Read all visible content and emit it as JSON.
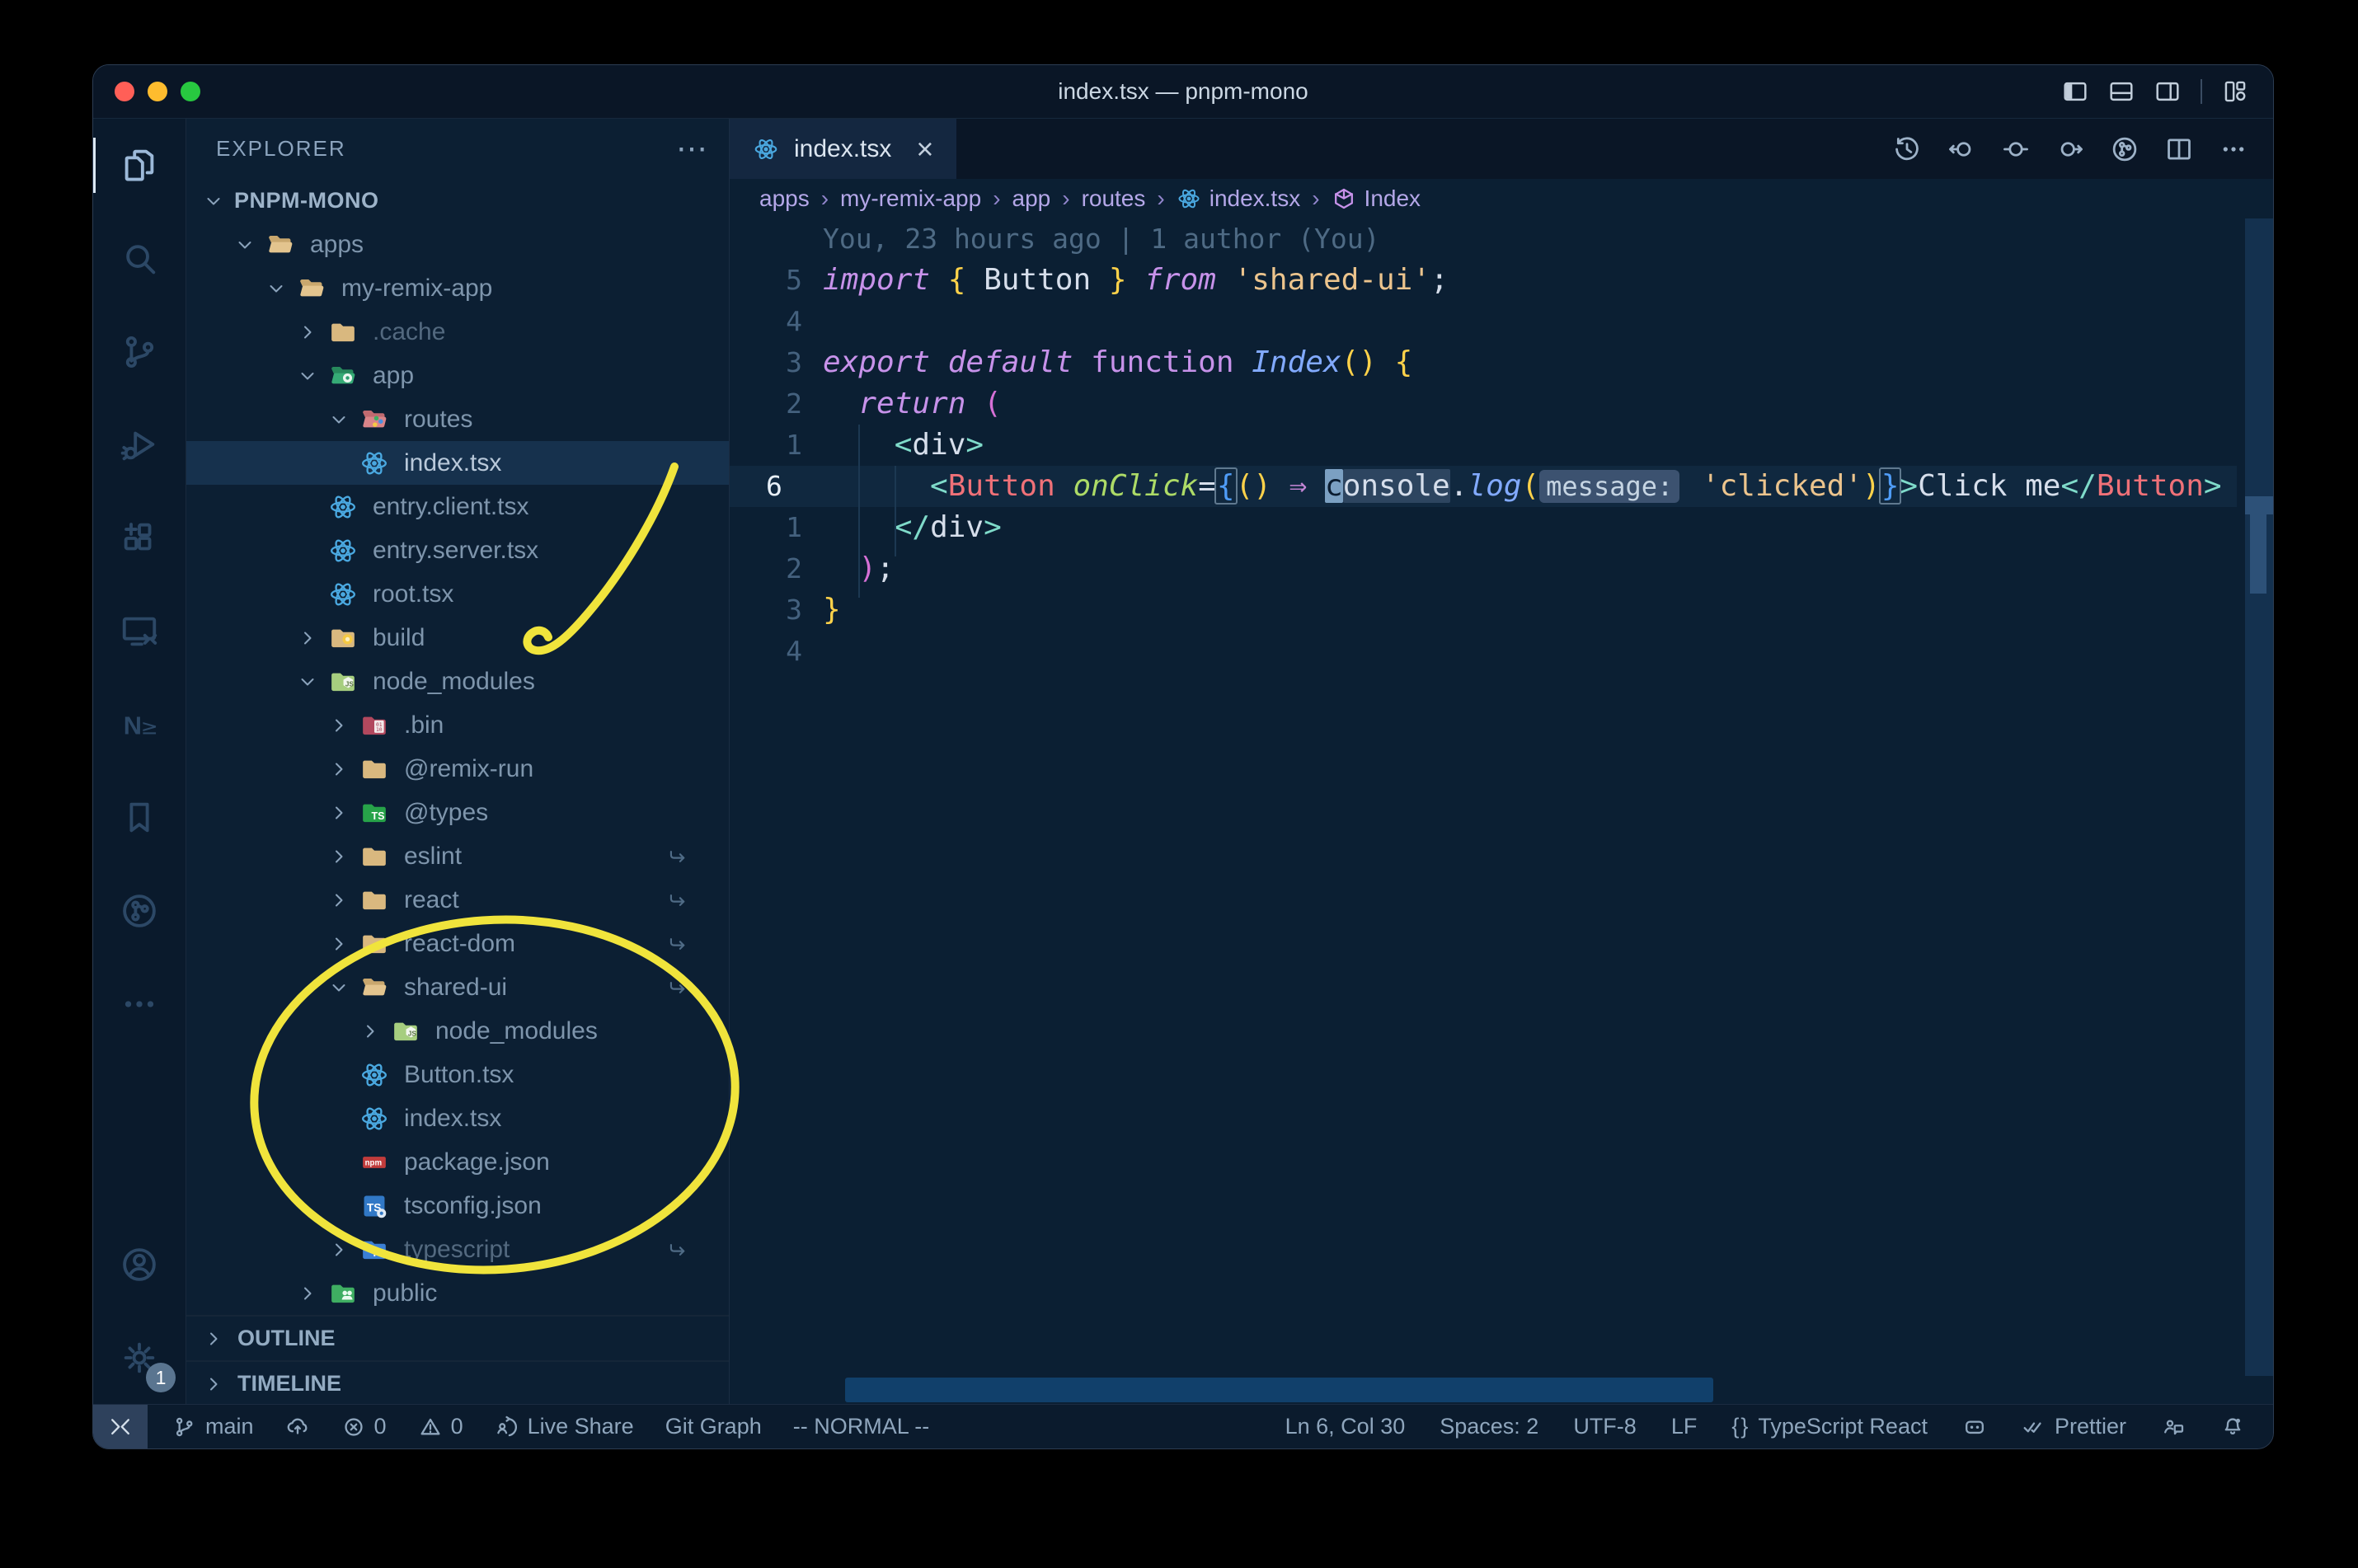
{
  "titlebar": {
    "title": "index.tsx — pnpm-mono",
    "traffic_lights": [
      "close",
      "minimize",
      "zoom"
    ],
    "layout_icons": [
      "panel-left",
      "panel-bottom",
      "panel-right",
      "layout-customize"
    ]
  },
  "colors": {
    "traffic_close": "#ff5f57",
    "traffic_min": "#febc2e",
    "traffic_zoom": "#28c840",
    "annotation_yellow": "#f0e43c",
    "editor_bg": "#0b1f33",
    "sidebar_bg": "#0c1f33",
    "statusbar_bg": "#0b1b2d",
    "keyword": "#c792ea",
    "string": "#ecc48d",
    "function": "#82aaff",
    "tag": "#f07178",
    "attribute": "#addb67",
    "punct_teal": "#7fdbca",
    "bracket_gold": "#ffd24a",
    "bracket_magenta": "#d670d6",
    "bracket_blue": "#4f9cf7"
  },
  "activity_bar": {
    "top": [
      {
        "name": "files",
        "active": true
      },
      {
        "name": "search"
      },
      {
        "name": "source-control"
      },
      {
        "name": "run-debug"
      },
      {
        "name": "extensions"
      },
      {
        "name": "remote-explorer"
      },
      {
        "name": "nx-console"
      },
      {
        "name": "bookmarks"
      },
      {
        "name": "git-graph"
      },
      {
        "name": "more"
      }
    ],
    "bottom": [
      {
        "name": "account"
      },
      {
        "name": "settings",
        "badge": "1"
      }
    ]
  },
  "explorer": {
    "header": "EXPLORER",
    "more_label": "⋯",
    "project_label": "PNPM-MONO",
    "outline_label": "OUTLINE",
    "timeline_label": "TIMELINE",
    "tree": [
      {
        "label": "apps",
        "level": 1,
        "expanded": true,
        "icon": "folder-tan-open"
      },
      {
        "label": "my-remix-app",
        "level": 2,
        "expanded": true,
        "icon": "folder-tan-open"
      },
      {
        "label": ".cache",
        "level": 3,
        "expanded": false,
        "icon": "folder-tan",
        "dim": true
      },
      {
        "label": "app",
        "level": 3,
        "expanded": true,
        "icon": "folder-app"
      },
      {
        "label": "routes",
        "level": 4,
        "expanded": true,
        "icon": "folder-routes"
      },
      {
        "label": "index.tsx",
        "level": 5,
        "icon": "react",
        "selected": true
      },
      {
        "label": "entry.client.tsx",
        "level": 4,
        "icon": "react"
      },
      {
        "label": "entry.server.tsx",
        "level": 4,
        "icon": "react"
      },
      {
        "label": "root.tsx",
        "level": 4,
        "icon": "react"
      },
      {
        "label": "build",
        "level": 3,
        "expanded": false,
        "icon": "folder-build"
      },
      {
        "label": "node_modules",
        "level": 3,
        "expanded": true,
        "icon": "folder-nodemodules"
      },
      {
        "label": ".bin",
        "level": 4,
        "expanded": false,
        "icon": "folder-bin"
      },
      {
        "label": "@remix-run",
        "level": 4,
        "expanded": false,
        "icon": "folder-tan"
      },
      {
        "label": "@types",
        "level": 4,
        "expanded": false,
        "icon": "folder-types"
      },
      {
        "label": "eslint",
        "level": 4,
        "expanded": false,
        "icon": "folder-tan",
        "symlink": true
      },
      {
        "label": "react",
        "level": 4,
        "expanded": false,
        "icon": "folder-tan",
        "symlink": true
      },
      {
        "label": "react-dom",
        "level": 4,
        "expanded": false,
        "icon": "folder-tan",
        "symlink": true
      },
      {
        "label": "shared-ui",
        "level": 4,
        "expanded": true,
        "icon": "folder-tan-open",
        "symlink": true
      },
      {
        "label": "node_modules",
        "level": 5,
        "expanded": false,
        "icon": "folder-nodemodules"
      },
      {
        "label": "Button.tsx",
        "level": 5,
        "icon": "react"
      },
      {
        "label": "index.tsx",
        "level": 5,
        "icon": "react"
      },
      {
        "label": "package.json",
        "level": 5,
        "icon": "npm"
      },
      {
        "label": "tsconfig.json",
        "level": 5,
        "icon": "tsconfig"
      },
      {
        "label": "typescript",
        "level": 4,
        "expanded": false,
        "icon": "folder-ts",
        "symlink": true,
        "dim": true
      },
      {
        "label": "public",
        "level": 3,
        "expanded": false,
        "icon": "folder-public"
      }
    ]
  },
  "editor_tabs": {
    "active_tab": {
      "label": "index.tsx",
      "icon": "react",
      "close": "×"
    },
    "actions": [
      "history",
      "nav-back",
      "nav-dot",
      "nav-forward",
      "git-graph",
      "split-editor",
      "more"
    ]
  },
  "breadcrumbs": {
    "separator": "›",
    "items": [
      {
        "label": "apps"
      },
      {
        "label": "my-remix-app"
      },
      {
        "label": "app"
      },
      {
        "label": "routes"
      },
      {
        "label": "index.tsx",
        "icon": "react"
      },
      {
        "label": "Index",
        "icon": "symbol-module"
      }
    ]
  },
  "editor": {
    "blame": "You, 23 hours ago | 1 author (You)",
    "cursor_position": "Ln 6, Col 30",
    "lines": [
      {
        "num": "5",
        "tokens": [
          [
            "kw",
            "import"
          ],
          [
            "txt",
            " "
          ],
          [
            "br1",
            "{"
          ],
          [
            "txt",
            " Button "
          ],
          [
            "br1",
            "}"
          ],
          [
            "txt",
            " "
          ],
          [
            "kw",
            "from"
          ],
          [
            "txt",
            " "
          ],
          [
            "str",
            "'shared-ui'"
          ],
          [
            "pun",
            ";"
          ]
        ]
      },
      {
        "num": "4",
        "tokens": []
      },
      {
        "num": "3",
        "tokens": [
          [
            "kw",
            "export"
          ],
          [
            "txt",
            " "
          ],
          [
            "kw",
            "default"
          ],
          [
            "txt",
            " "
          ],
          [
            "kwu",
            "function"
          ],
          [
            "txt",
            " "
          ],
          [
            "fn",
            "Index"
          ],
          [
            "br1",
            "()"
          ],
          [
            "txt",
            " "
          ],
          [
            "br1",
            "{"
          ]
        ]
      },
      {
        "num": "2",
        "tokens": [
          [
            "txt",
            "  "
          ],
          [
            "kw",
            "return"
          ],
          [
            "txt",
            " "
          ],
          [
            "br2",
            "("
          ]
        ]
      },
      {
        "num": "1",
        "tokens": [
          [
            "txt",
            "    "
          ],
          [
            "tp",
            "<"
          ],
          [
            "txt",
            "div"
          ],
          [
            "tp",
            ">"
          ]
        ]
      },
      {
        "num": "6",
        "current": true,
        "tokens": [
          [
            "txt",
            "      "
          ],
          [
            "tp",
            "<"
          ],
          [
            "tag",
            "Button"
          ],
          [
            "txt",
            " "
          ],
          [
            "attr",
            "onClick"
          ],
          [
            "pun",
            "="
          ],
          [
            "br3x",
            "{"
          ],
          [
            "br1",
            "("
          ],
          [
            "br1",
            ")"
          ],
          [
            "txt",
            " "
          ],
          [
            "arr",
            "⇒"
          ],
          [
            "txt",
            " "
          ],
          [
            "cur",
            "c"
          ],
          [
            "whl",
            "onsole"
          ],
          [
            "pun",
            "."
          ],
          [
            "fn",
            "log"
          ],
          [
            "br1",
            "("
          ],
          [
            "chip",
            "message:"
          ],
          [
            "txt",
            " "
          ],
          [
            "str",
            "'clicked'"
          ],
          [
            "br1",
            ")"
          ],
          [
            "br3x",
            "}"
          ],
          [
            "tp",
            ">"
          ],
          [
            "txt",
            "Click me"
          ],
          [
            "tp",
            "</"
          ],
          [
            "tag",
            "Button"
          ],
          [
            "tp",
            ">"
          ]
        ]
      },
      {
        "num": "1",
        "tokens": [
          [
            "txt",
            "    "
          ],
          [
            "tp",
            "</"
          ],
          [
            "txt",
            "div"
          ],
          [
            "tp",
            ">"
          ]
        ]
      },
      {
        "num": "2",
        "tokens": [
          [
            "txt",
            "  "
          ],
          [
            "br2",
            ")"
          ],
          [
            "pun",
            ";"
          ]
        ]
      },
      {
        "num": "3",
        "tokens": [
          [
            "br1",
            "}"
          ]
        ]
      },
      {
        "num": "4",
        "tokens": []
      }
    ]
  },
  "statusbar": {
    "left": [
      {
        "icon": "branch",
        "label": "main"
      },
      {
        "icon": "cloud-upload",
        "label": ""
      },
      {
        "icon": "error-circle",
        "label": "0"
      },
      {
        "icon": "warning-triangle",
        "label": "0"
      },
      {
        "icon": "live-share",
        "label": "Live Share"
      },
      {
        "label": "Git Graph"
      },
      {
        "label": "-- NORMAL --"
      }
    ],
    "right": [
      {
        "label": "Ln 6, Col 30"
      },
      {
        "label": "Spaces: 2"
      },
      {
        "label": "UTF-8"
      },
      {
        "label": "LF"
      },
      {
        "icon": "braces",
        "label": "TypeScript React"
      },
      {
        "icon": "copilot",
        "label": ""
      },
      {
        "icon": "double-check",
        "label": "Prettier"
      },
      {
        "icon": "feedback",
        "label": ""
      },
      {
        "icon": "bell-dot",
        "label": ""
      }
    ]
  },
  "annotations": {
    "color": "#f0e43c",
    "items": [
      "hand-drawn arrow pointing to node_modules",
      "hand-drawn ellipse around shared-ui package files"
    ]
  }
}
